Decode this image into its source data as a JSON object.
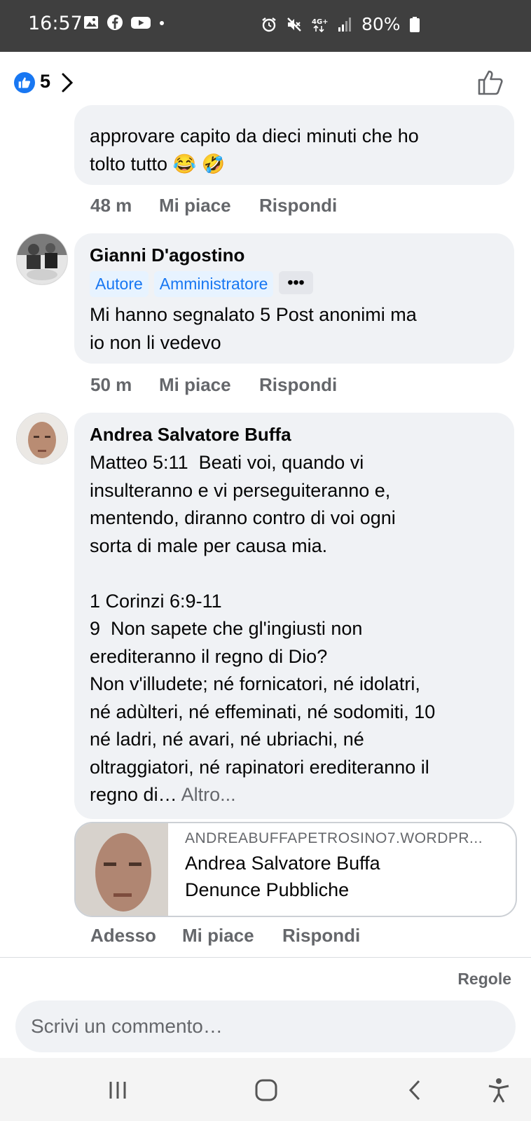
{
  "status_bar": {
    "time": "16:57",
    "battery": "80%",
    "network": "4G+"
  },
  "reactions": {
    "count": "5"
  },
  "comments": [
    {
      "partial_text": "approvare capito da dieci minuti che ho\ntolto tutto 😂 🤣",
      "time": "48 m",
      "like": "Mi piace",
      "reply": "Rispondi"
    },
    {
      "author": "Gianni D'agostino",
      "badges": [
        "Autore",
        "Amministratore"
      ],
      "badges_more": "•••",
      "text": "Mi hanno segnalato 5 Post anonimi ma\nio non li vedevo",
      "time": "50 m",
      "like": "Mi piace",
      "reply": "Rispondi"
    },
    {
      "author": "Andrea Salvatore Buffa",
      "text": "Matteo 5:11  Beati voi, quando vi\ninsulteranno e vi perseguiteranno e,\nmentendo, diranno contro di voi ogni\nsorta di male per causa mia.\n\n1 Corinzi 6:9-11\n9  Non sapete che gl'ingiusti non\nerediteranno il regno di Dio?\nNon v'illudete; né fornicatori, né idolatri,\nné adùlteri, né effeminati, né sodomiti, 10\nné ladri, né avari, né ubriachi, né\noltraggiatori, né rapinatori erediteranno il\nregno di… ",
      "see_more": "Altro...",
      "link": {
        "domain": "ANDREABUFFAPETROSINO7.WORDPR...",
        "title": "Andrea Salvatore Buffa\nDenunce Pubbliche"
      },
      "time": "Adesso",
      "like": "Mi piace",
      "reply": "Rispondi"
    }
  ],
  "footer": {
    "rules": "Regole",
    "input_placeholder": "Scrivi un commento…"
  },
  "colors": {
    "accent": "#1877f2",
    "bubble": "#f0f2f5",
    "secondary_text": "#65676b"
  }
}
